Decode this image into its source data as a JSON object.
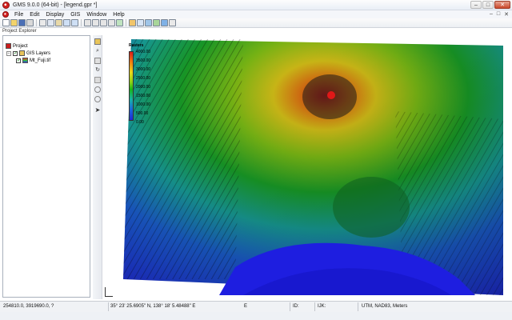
{
  "window": {
    "title": "GMS 9.0.0 (64-bit) - [legend.gpr *]",
    "controls": {
      "minimize": "–",
      "maximize": "□",
      "close": "✕"
    }
  },
  "menu": {
    "items": [
      "File",
      "Edit",
      "Display",
      "GIS",
      "Window",
      "Help"
    ],
    "right_controls": [
      "–",
      "□",
      "✕"
    ]
  },
  "toolbar": {
    "icons": [
      "new-icon",
      "open-icon",
      "save-icon",
      "print-icon",
      "cut-icon",
      "copy-icon",
      "paste-icon",
      "undo-icon",
      "redo-icon",
      "rotate-icon",
      "pan-icon",
      "zoom-icon",
      "frame-icon",
      "refresh-icon",
      "layers-icon",
      "grid-icon",
      "module-icon",
      "map-icon",
      "globe-icon",
      "info-icon"
    ]
  },
  "explorer": {
    "title": "Project Explorer",
    "tree": [
      {
        "label": "Project",
        "level": 0
      },
      {
        "label": "GIS Layers",
        "level": 1
      },
      {
        "label": "Mt_Fuji.tif",
        "level": 2
      }
    ]
  },
  "map": {
    "legend": {
      "title": "Rasters",
      "labels": [
        "4000.00",
        "3500.00",
        "3000.00",
        "2500.00",
        "2000.00",
        "1500.00",
        "1000.00",
        "500.00",
        "0.00"
      ]
    }
  },
  "status": {
    "coords": "254810.0, 3919690.0, ?",
    "latlon": "35° 23' 25.6905\" N, 138° 18' 5.48488\" E",
    "e": "E",
    "id_label": "ID:",
    "ijk_label": "IJK:",
    "projection": "UTM, NAD83, Meters"
  }
}
